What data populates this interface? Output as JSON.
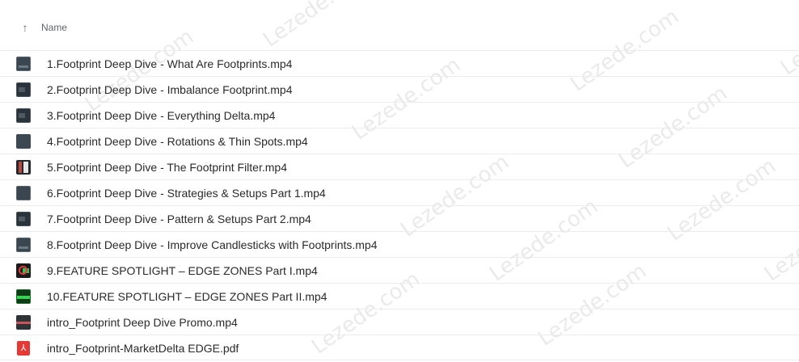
{
  "header": {
    "sort_icon": "arrow-up-icon",
    "name_label": "Name"
  },
  "files": [
    {
      "name": "1.Footprint Deep Dive - What Are Footprints.mp4",
      "thumb": "video-thumbnail"
    },
    {
      "name": "2.Footprint Deep Dive - Imbalance Footprint.mp4",
      "thumb": "video-thumbnail"
    },
    {
      "name": "3.Footprint Deep Dive - Everything Delta.mp4",
      "thumb": "video-thumbnail"
    },
    {
      "name": "4.Footprint Deep Dive - Rotations & Thin Spots.mp4",
      "thumb": "video-thumbnail"
    },
    {
      "name": "5.Footprint Deep Dive - The Footprint Filter.mp4",
      "thumb": "video-thumbnail"
    },
    {
      "name": "6.Footprint Deep Dive - Strategies & Setups Part 1.mp4",
      "thumb": "video-thumbnail"
    },
    {
      "name": "7.Footprint Deep Dive - Pattern & Setups Part 2.mp4",
      "thumb": "video-thumbnail"
    },
    {
      "name": "8.Footprint Deep Dive - Improve Candlesticks with Footprints.mp4",
      "thumb": "video-thumbnail"
    },
    {
      "name": "9.FEATURE SPOTLIGHT – EDGE ZONES Part I.mp4",
      "thumb": "video-thumbnail"
    },
    {
      "name": "10.FEATURE SPOTLIGHT – EDGE ZONES Part II.mp4",
      "thumb": "video-thumbnail"
    },
    {
      "name": "intro_Footprint Deep Dive Promo.mp4",
      "thumb": "video-thumbnail"
    },
    {
      "name": "intro_Footprint-MarketDelta EDGE.pdf",
      "thumb": "pdf-icon"
    }
  ],
  "watermark": "Lezede.com",
  "colors": {
    "pdf_red": "#e53935",
    "row_divider": "#ececec"
  }
}
